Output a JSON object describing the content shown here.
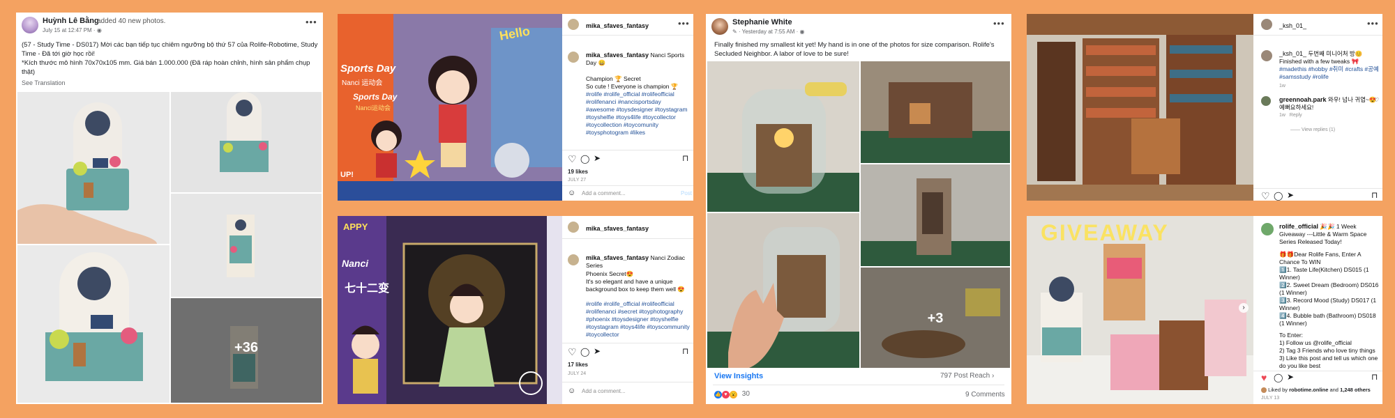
{
  "colors": {
    "background": "#f4a261",
    "link": "#1f4e96",
    "heart": "#ed4956"
  },
  "fb1": {
    "author": "Huỳnh Lê Bằng",
    "action": "added 40 new photos.",
    "meta": "July 15 at 12:47 PM · ",
    "body": "(57 - Study Time - DS017) Mời các bạn tiếp tục chiêm ngưỡng bộ thứ 57 của Rolife-Robotime, Study Time - Đã tới giờ học rồi!\n*Kích thước mô hình 70x70x105 mm. Giá bán 1.000.000 (Đã ráp hoàn chỉnh, hình sản phẩm chụp thật)",
    "see_translation": "See Translation",
    "more_count": "+36"
  },
  "ig1": {
    "username": "mika_sfaves_fantasy",
    "caption_user": "mika_sfaves_fantasy",
    "caption_text": "Nanci Sports Day 😄",
    "caption_lines": [
      "Champion 🏆 Secret",
      "So cute ! Everyone is champion 🏆"
    ],
    "hashtags": "#rolife #rolife_official #rolifeofficial #rolifenanci #nancisportsday #awesome #toysdesigner #toystagram #toyshelfie #toys4life #toycollector #toycollection #toycomunity #toysphotogram #likes",
    "likes": "19 likes",
    "date": "JULY 27",
    "comment_placeholder": "Add a comment...",
    "post_label": "Post",
    "photo_texts": {
      "sports": "Sports Day",
      "sports_cn": "Nanci 运动会",
      "sports2": "Sports Day",
      "sports2_cn": "Nanci运动会",
      "hello": "Hello",
      "up": "UP!"
    }
  },
  "ig2": {
    "username": "mika_sfaves_fantasy",
    "caption_user": "mika_sfaves_fantasy",
    "caption_text": "Nanci Zodiac Series",
    "caption_lines": [
      "Phoenix Secret😍",
      "It's so elegant and have a unique background box to keep them well 😍"
    ],
    "hashtags": "#rolife #rolife_official #rolifeofficial #rolifenanci #secret #toyphotography #phoenix #toysdesigner #toyshelfie #toystagram #toys4life #toyscommunity #toycollector",
    "likes": "17 likes",
    "date": "JULY 24",
    "comment_placeholder": "Add a comment...",
    "photo_texts": {
      "nanci": "Nanci",
      "zodiac": "七十二变",
      "appy": "APPY"
    }
  },
  "fb2": {
    "author": "Stephanie White",
    "meta": "· Yesterday at 7:55 AM · ",
    "body": "Finally finished my smallest kit yet! My hand is in one of the photos for size comparison. Rolife's Secluded Neighbor. A labor of love to be sure!",
    "more_count": "+3",
    "view_insights": "View Insights",
    "post_reach": "797 Post Reach",
    "reaction_count": "30",
    "comments": "9 Comments"
  },
  "ig3": {
    "username": "_ksh_01_",
    "caption_user": "_ksh_01_",
    "caption_text": "두번째 미니어처 방😊",
    "caption_lines": [
      "Finished with a few tweaks 🎀"
    ],
    "hashtags": "#madethis #hobby #취미 #crafts #공예 #samsstudy #rolife",
    "caption_time": "1w",
    "commenter": "greennoah.park",
    "comment_text": "와우! 넘나 귀엽~😍 예뻐요하세요!",
    "comment_meta": "1w   Reply",
    "view_replies": "View replies (1)"
  },
  "ig4": {
    "username": "rolife_official",
    "caption_text": "🎉🎉 1 Week Giveaway ---Little & Warm Space Series Released Today!",
    "lines": [
      "🎁🎁Dear Rolife Fans, Enter A Chance To WIN",
      "1️⃣1. Taste Life(Kitchen) DS015 (1 Winner)",
      "2️⃣2. Sweet Dream (Bedroom) DS016 (1 Winner)",
      "3️⃣3. Record Mood (Study) DS017 (1 Winner)",
      "4️⃣4. Bubble bath (Bathroom) DS018 (1 Winner)",
      "",
      "To Enter:",
      "1) Follow us @rolife_official",
      "2) Tag 3 Friends who love tiny things",
      "3) Like this post and tell us which one do you like best"
    ],
    "liked_by": "Liked by",
    "liked_user": "robotime.online",
    "liked_and": "and",
    "liked_others": "1,248 others",
    "date": "JULY 13",
    "photo_text": "GIVEAWAY"
  }
}
